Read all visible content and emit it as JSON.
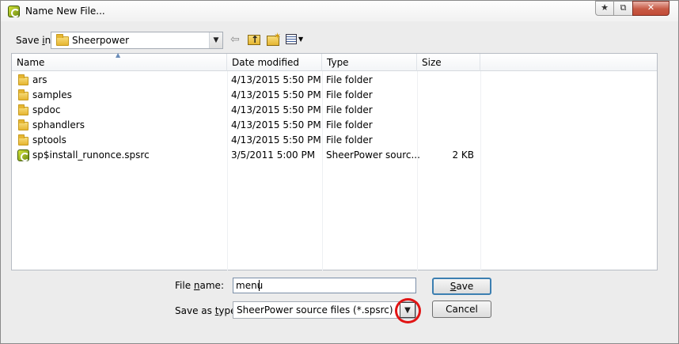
{
  "window": {
    "title": "Name New File...",
    "controls": {
      "star": "★",
      "pin": "⧉",
      "close": "✕"
    }
  },
  "toolbar": {
    "save_in_label_pre": "Save ",
    "save_in_label_ul": "i",
    "save_in_label_post": "n:",
    "save_in_value": "Sheerpower",
    "icons": [
      "back-arrow-icon",
      "up-folder-icon",
      "new-folder-icon",
      "views-menu-icon"
    ]
  },
  "columns": {
    "name": "Name",
    "date": "Date modified",
    "type": "Type",
    "size": "Size"
  },
  "files": [
    {
      "name": "ars",
      "date": "4/13/2015 5:50 PM",
      "type": "File folder",
      "size": "",
      "icon": "folder"
    },
    {
      "name": "samples",
      "date": "4/13/2015 5:50 PM",
      "type": "File folder",
      "size": "",
      "icon": "folder"
    },
    {
      "name": "spdoc",
      "date": "4/13/2015 5:50 PM",
      "type": "File folder",
      "size": "",
      "icon": "folder"
    },
    {
      "name": "sphandlers",
      "date": "4/13/2015 5:50 PM",
      "type": "File folder",
      "size": "",
      "icon": "folder"
    },
    {
      "name": "sptools",
      "date": "4/13/2015 5:50 PM",
      "type": "File folder",
      "size": "",
      "icon": "folder"
    },
    {
      "name": "sp$install_runonce.spsrc",
      "date": "3/5/2011 5:00 PM",
      "type": "SheerPower sourc...",
      "size": "2 KB",
      "icon": "sheerpower-file"
    }
  ],
  "form": {
    "file_name_label_pre": "File ",
    "file_name_label_ul": "n",
    "file_name_label_post": "ame:",
    "file_name_value": "menu",
    "save_type_label_pre": "Save as ",
    "save_type_label_ul": "t",
    "save_type_label_post": "ype:",
    "save_type_value": "SheerPower source files (*.spsrc)",
    "save_button_ul": "S",
    "save_button_rest": "ave",
    "cancel_button": "Cancel"
  },
  "colors": {
    "highlight_ring": "#e11414",
    "accent": "#3c7fb1"
  }
}
